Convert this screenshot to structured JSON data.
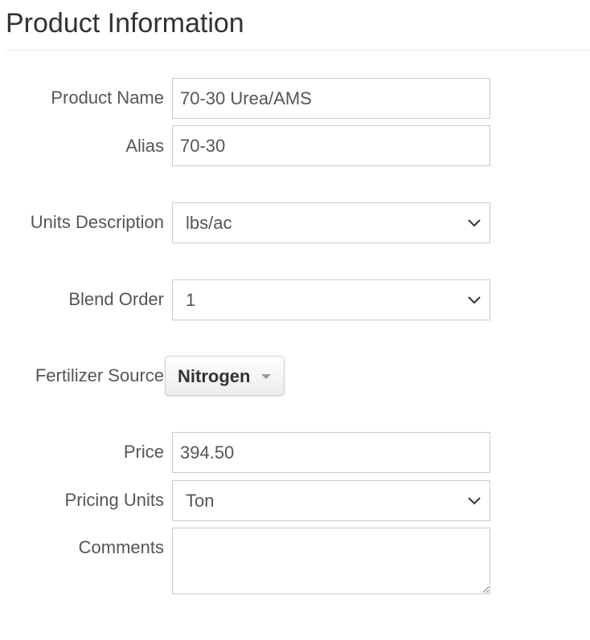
{
  "header": {
    "title": "Product Information"
  },
  "form": {
    "product_name": {
      "label": "Product Name",
      "value": "70-30 Urea/AMS"
    },
    "alias": {
      "label": "Alias",
      "value": "70-30"
    },
    "units_description": {
      "label": "Units Description",
      "value": "lbs/ac"
    },
    "blend_order": {
      "label": "Blend Order",
      "value": "1"
    },
    "fertilizer_source": {
      "label": "Fertilizer Source",
      "value": "Nitrogen"
    },
    "price": {
      "label": "Price",
      "value": "394.50"
    },
    "pricing_units": {
      "label": "Pricing Units",
      "value": "Ton"
    },
    "comments": {
      "label": "Comments",
      "value": ""
    }
  },
  "colors": {
    "text": "#333333",
    "label": "#555555",
    "border": "#cccccc"
  },
  "icons": {
    "select_arrow": "chevron-down-icon",
    "dropdown_caret": "caret-down-icon",
    "resize_handle": "resize-grip-icon"
  }
}
